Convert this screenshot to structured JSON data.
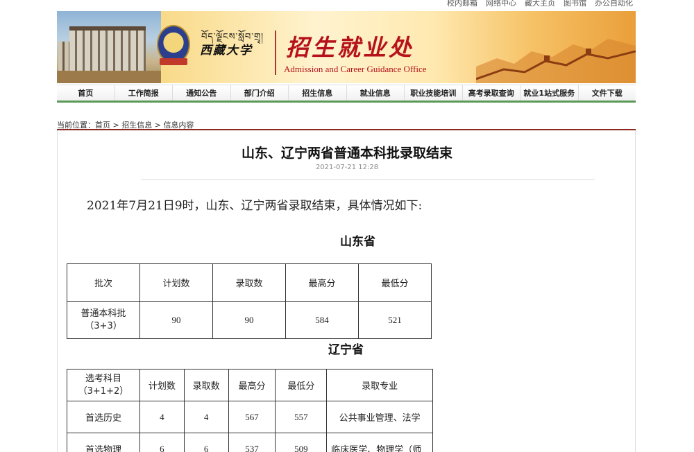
{
  "top_links": [
    "校内邮箱",
    "网络中心",
    "藏大主页",
    "图书馆",
    "办公自动化"
  ],
  "banner": {
    "tibetan_script": "བོད་ལྗོངས་སློབ་གྲྭ།",
    "university_name": "西藏大学",
    "office_name_zh": "招生就业处",
    "office_name_en": "Admission and Career Guidance Office"
  },
  "nav": [
    "首页",
    "工作简报",
    "通知公告",
    "部门介绍",
    "招生信息",
    "就业信息",
    "职业技能培训",
    "高考录取查询",
    "就业1站式服务",
    "文件下载"
  ],
  "breadcrumb": {
    "label": "当前位置：",
    "items": [
      "首页",
      "招生信息",
      "信息内容"
    ],
    "separator": ">"
  },
  "article": {
    "title": "山东、辽宁两省普通本科批录取结束",
    "date": "2021-07-21 12:28",
    "intro": "2021年7月21日9时，山东、辽宁两省录取结束，具体情况如下:"
  },
  "shandong": {
    "heading": "山东省",
    "headers": [
      "批次",
      "计划数",
      "录取数",
      "最高分",
      "最低分"
    ],
    "row": [
      "普通本科批\n（3+3）",
      "90",
      "90",
      "584",
      "521"
    ]
  },
  "liaoning": {
    "heading": "辽宁省",
    "headers": [
      "选考科目\n（3+1+2）",
      "计划数",
      "录取数",
      "最高分",
      "最低分",
      "录取专业"
    ],
    "rows": [
      [
        "首选历史",
        "4",
        "4",
        "567",
        "557",
        "公共事业管理、法学"
      ],
      [
        "首选物理",
        "6",
        "6",
        "537",
        "509",
        "临床医学、物理学（师"
      ]
    ]
  }
}
